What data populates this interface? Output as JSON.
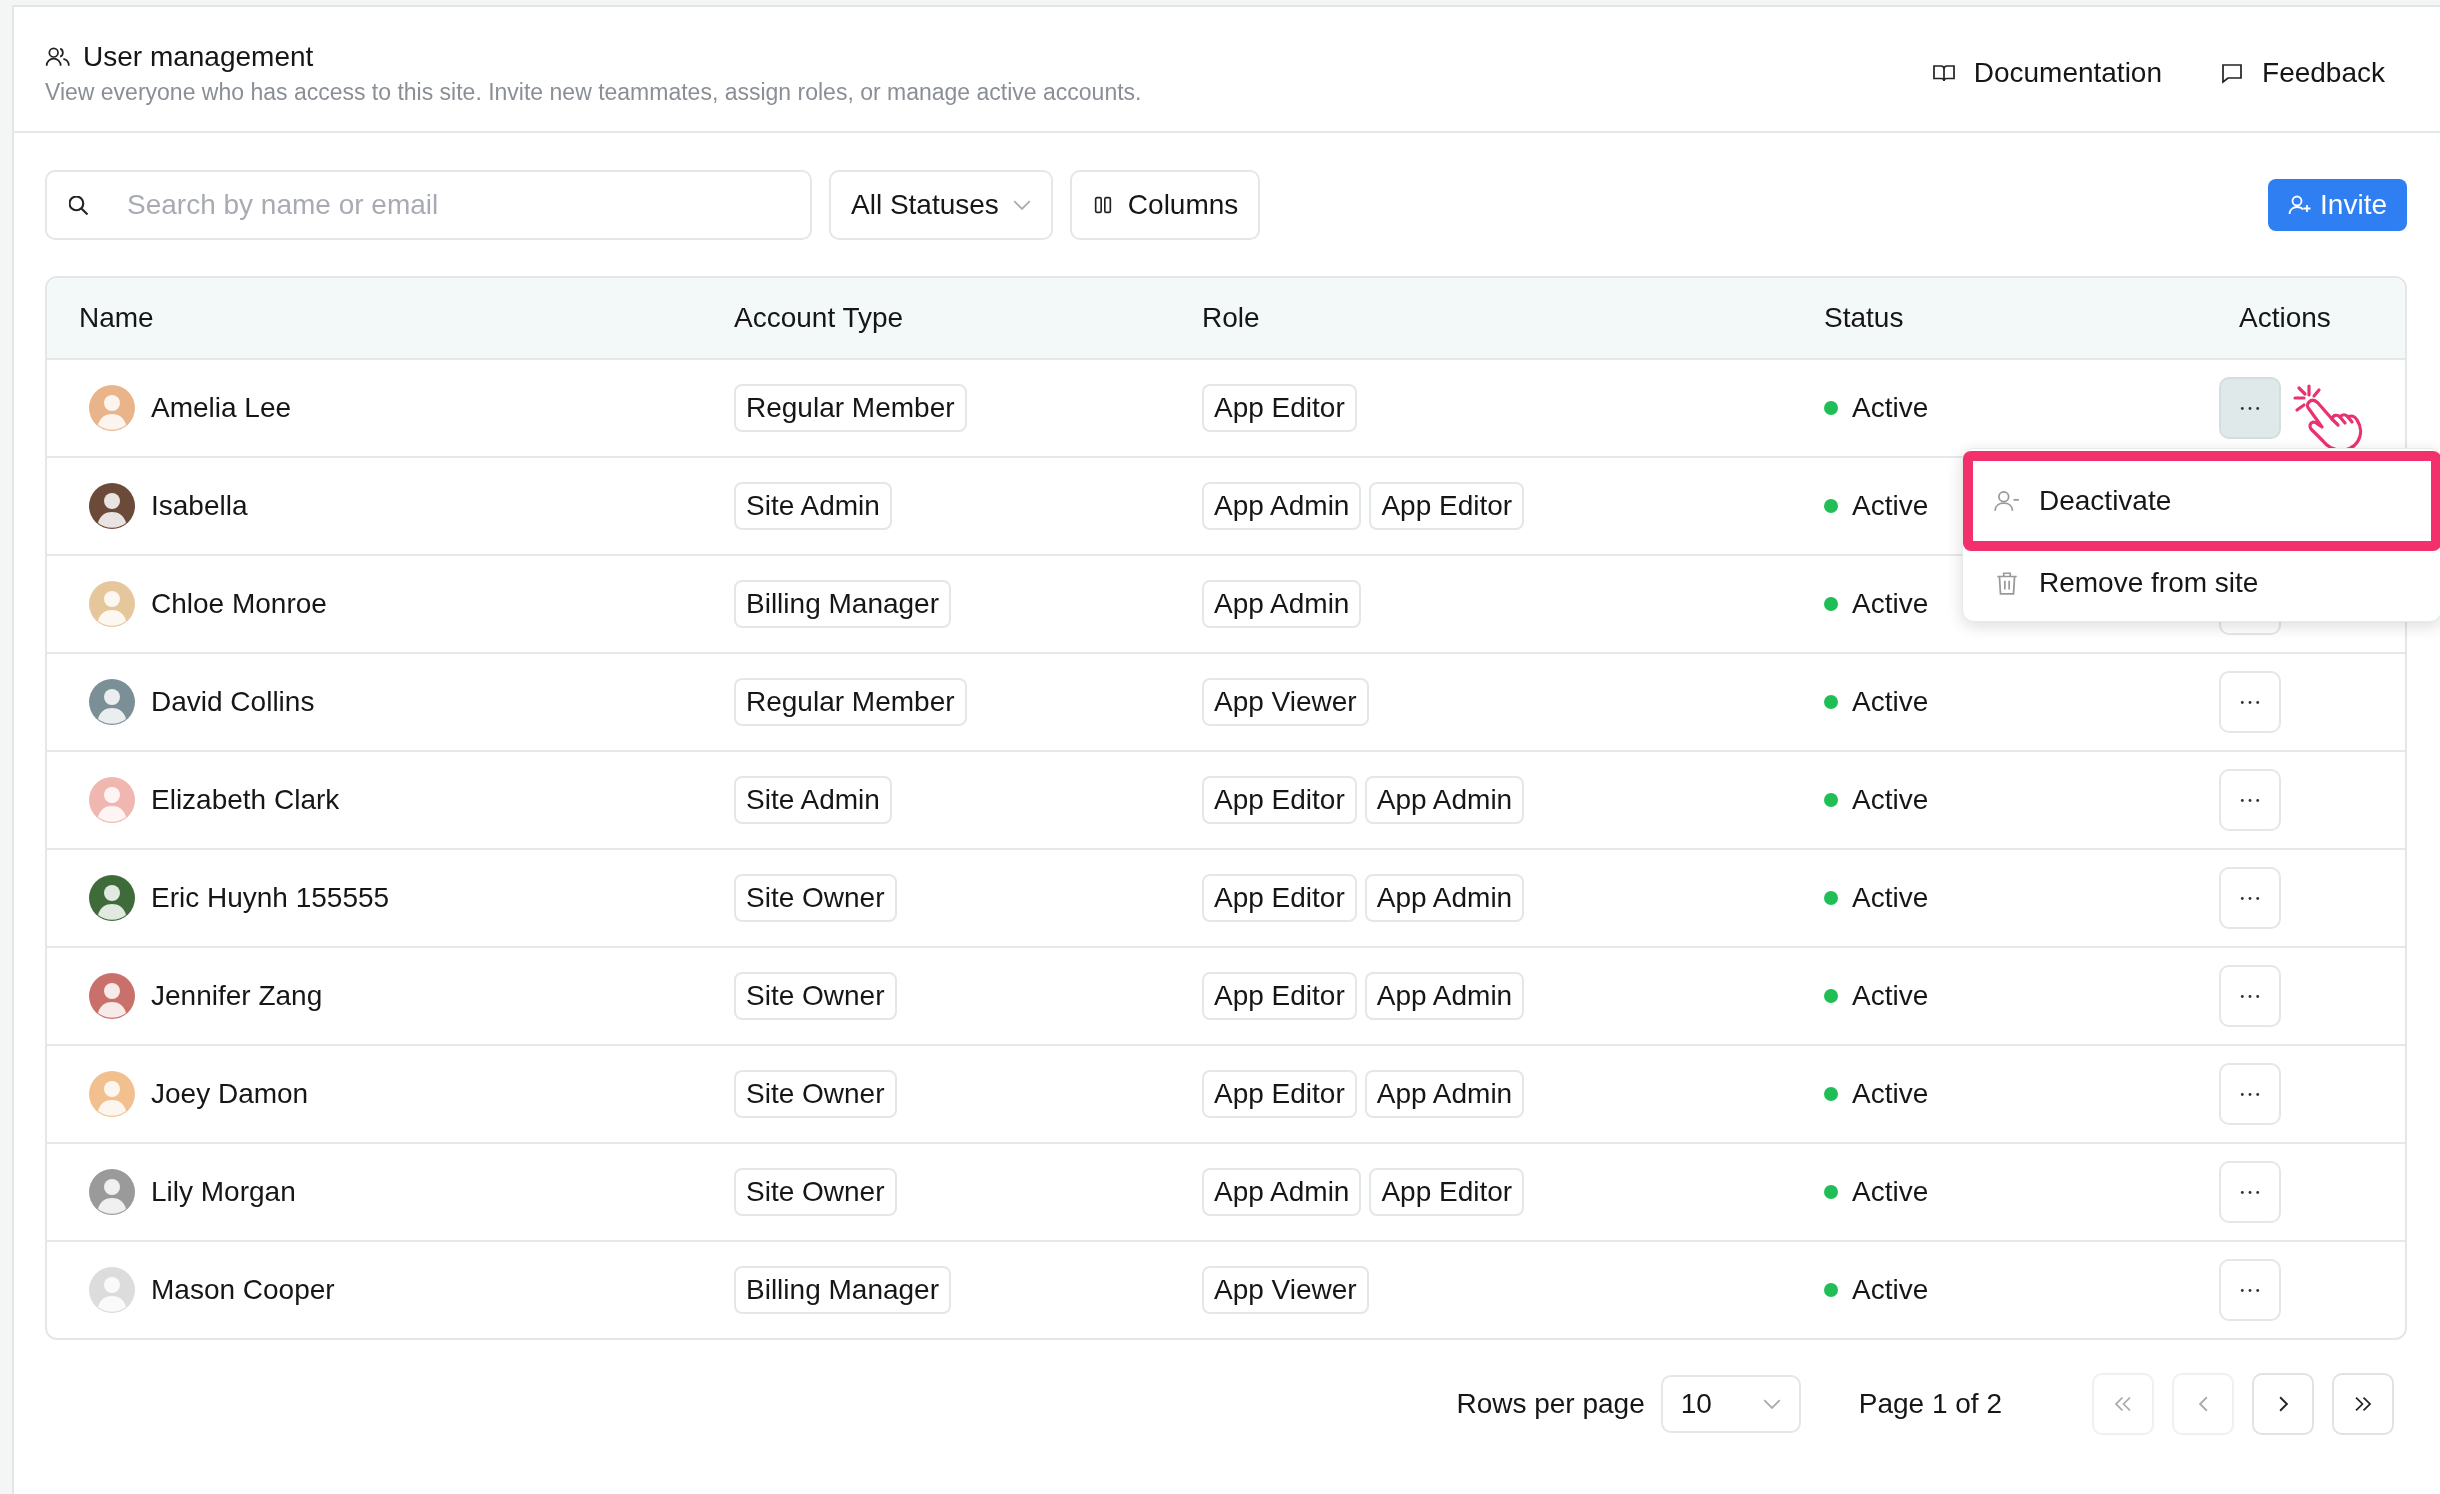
{
  "header": {
    "title": "User management",
    "subtitle": "View everyone who has access to this site. Invite new teammates, assign roles, or manage active accounts.",
    "links": [
      {
        "kind": "docs",
        "label": "Documentation"
      },
      {
        "kind": "feedback",
        "label": "Feedback"
      }
    ]
  },
  "toolbar": {
    "search": {
      "placeholder": "Search by name or email"
    },
    "status_filter": "All Statuses",
    "columns_button": "Columns",
    "invite_button": "Invite"
  },
  "table": {
    "columns": [
      "Name",
      "Account Type",
      "Role",
      "Status",
      "Actions"
    ],
    "rows": [
      {
        "name": "Amelia Lee",
        "account_type": "Regular Member",
        "roles": [
          "App Editor"
        ],
        "status": "Active",
        "menu_open": true
      },
      {
        "name": "Isabella",
        "account_type": "Site Admin",
        "roles": [
          "App Admin",
          "App Editor"
        ],
        "status": "Active",
        "menu_open": false
      },
      {
        "name": "Chloe Monroe",
        "account_type": "Billing Manager",
        "roles": [
          "App Admin"
        ],
        "status": "Active",
        "menu_open": false
      },
      {
        "name": "David Collins",
        "account_type": "Regular Member",
        "roles": [
          "App Viewer"
        ],
        "status": "Active",
        "menu_open": false
      },
      {
        "name": "Elizabeth Clark",
        "account_type": "Site Admin",
        "roles": [
          "App Editor",
          "App Admin"
        ],
        "status": "Active",
        "menu_open": false
      },
      {
        "name": "Eric Huynh 155555",
        "account_type": "Site Owner",
        "roles": [
          "App Editor",
          "App Admin"
        ],
        "status": "Active",
        "menu_open": false
      },
      {
        "name": "Jennifer Zang",
        "account_type": "Site Owner",
        "roles": [
          "App Editor",
          "App Admin"
        ],
        "status": "Active",
        "menu_open": false
      },
      {
        "name": "Joey Damon",
        "account_type": "Site Owner",
        "roles": [
          "App Editor",
          "App Admin"
        ],
        "status": "Active",
        "menu_open": false
      },
      {
        "name": "Lily Morgan",
        "account_type": "Site Owner",
        "roles": [
          "App Admin",
          "App Editor"
        ],
        "status": "Active",
        "menu_open": false
      },
      {
        "name": "Mason Cooper",
        "account_type": "Billing Manager",
        "roles": [
          "App Viewer"
        ],
        "status": "Active",
        "menu_open": false
      }
    ]
  },
  "action_menu": {
    "items": [
      {
        "kind": "deactivate",
        "label": "Deactivate",
        "highlighted": true
      },
      {
        "kind": "remove",
        "label": "Remove from site",
        "highlighted": false
      }
    ]
  },
  "pagination": {
    "rows_label": "Rows per page",
    "rows_value": "10",
    "page_label": "Page 1 of 2",
    "buttons": [
      {
        "kind": "first",
        "disabled": true
      },
      {
        "kind": "prev",
        "disabled": true
      },
      {
        "kind": "next",
        "disabled": false
      },
      {
        "kind": "last",
        "disabled": false
      }
    ]
  }
}
